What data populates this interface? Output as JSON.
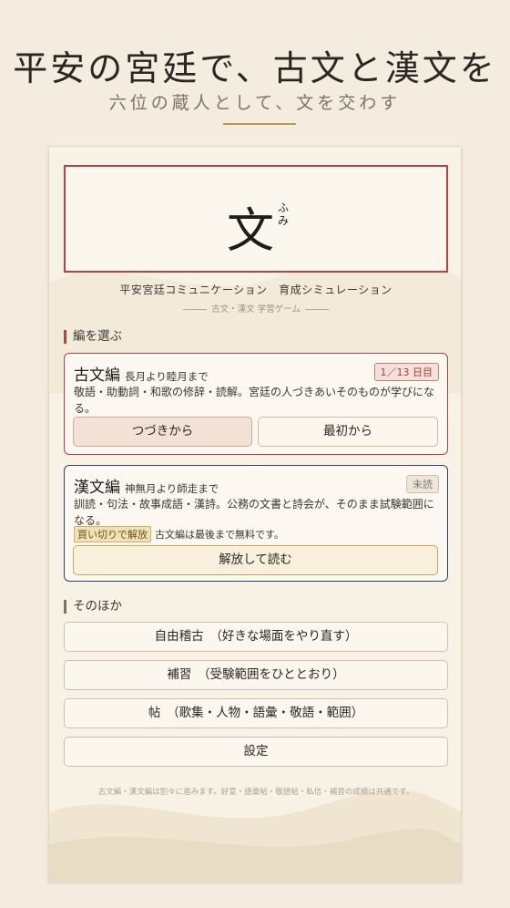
{
  "hero": {
    "title": "平安の宮廷で、古文と漢文を",
    "subtitle": "六位の蔵人として、文を交わす"
  },
  "logo": {
    "kanji": "文",
    "ruby": "ふみ",
    "subtitle": "平安宮廷コミュニケーション　育成シミュレーション",
    "tagline": "古文・漢文 学習ゲーム"
  },
  "chapters": {
    "label": "編を選ぶ",
    "kobun": {
      "name": "古文編",
      "period": "長月より睦月まで",
      "badge": "1／13 日目",
      "description": "敬語・助動詞・和歌の修辞・読解。宮廷の人づきあいそのものが学びになる。",
      "continue_label": "つづきから",
      "restart_label": "最初から"
    },
    "kanbun": {
      "name": "漢文編",
      "period": "神無月より師走まで",
      "badge": "未読",
      "description": "訓読・句法・故事成語・漢詩。公務の文書と詩会が、そのまま試験範囲になる。",
      "purchase_tag": "買い切りで解放",
      "purchase_note": "古文編は最後まで無料です。",
      "unlock_label": "解放して読む"
    }
  },
  "other": {
    "label": "そのほか",
    "items": [
      "自由稽古　（好きな場面をやり直す）",
      "補習　（受験範囲をひととおり）",
      "帖　（歌集・人物・語彙・敬語・範囲）",
      "設定"
    ]
  },
  "footnote": "古文編・漢文編は別々に進みます。好意・語彙帖・敬語帖・私信・補習の成績は共通です。",
  "colors": {
    "background": "#f3ecdf",
    "accent_red": "#b2453f",
    "accent_navy": "#2f4066",
    "gold": "#b8974f"
  }
}
